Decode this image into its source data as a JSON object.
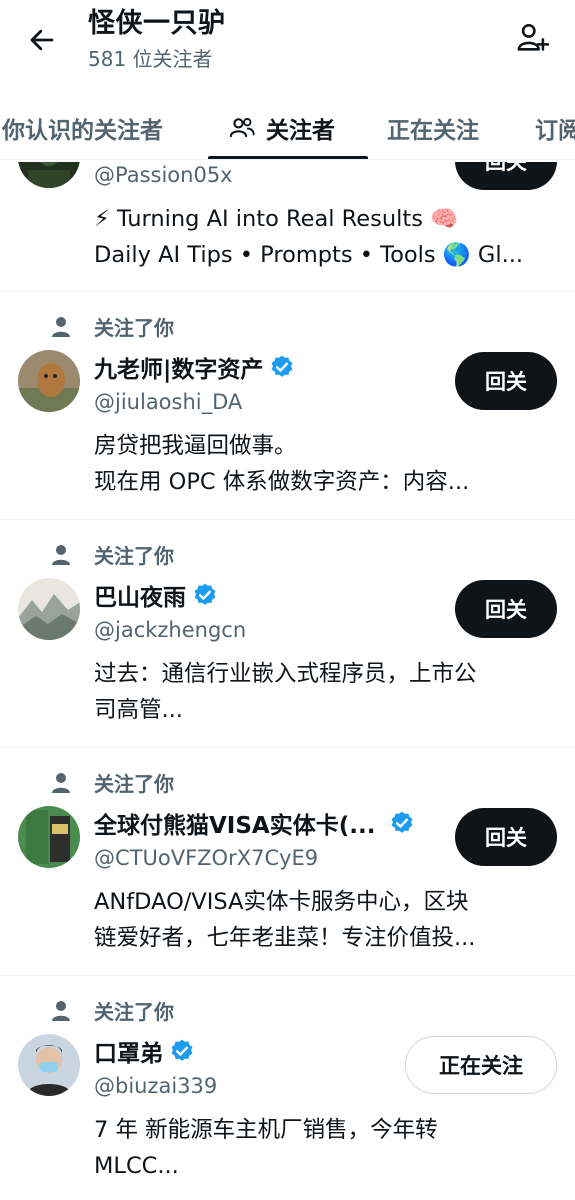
{
  "header": {
    "title": "怪侠一只驴",
    "subtitle": "581 位关注者"
  },
  "tabs": [
    {
      "label": "你认识的关注者"
    },
    {
      "label": "关注者"
    },
    {
      "label": "正在关注"
    },
    {
      "label": "订阅"
    }
  ],
  "followers": [
    {
      "handle": "@Passion05x",
      "bio1": "⚡ Turning AI into Real Results 🧠",
      "bio2": "Daily AI Tips • Prompts • Tools 🌎 Gl...",
      "button": "回关"
    },
    {
      "followed_text": "关注了你",
      "name": "九老师|数字资产",
      "handle": "@jiulaoshi_DA",
      "bio1": "房贷把我逼回做事。",
      "bio2": "现在用 OPC 体系做数字资产：内容...",
      "button": "回关"
    },
    {
      "followed_text": "关注了你",
      "name": "巴山夜雨",
      "handle": "@jackzhengcn",
      "bio1": "过去：通信行业嵌入式程序员，上市公",
      "bio2": "司高管...",
      "button": "回关"
    },
    {
      "followed_text": "关注了你",
      "name": "全球付熊猫VISA实体卡(...",
      "handle": "@CTUoVFZOrX7CyE9",
      "bio1": "ANfDAO/VISA实体卡服务中心，区块",
      "bio2": "链爱好者，七年老韭菜！专注价值投...",
      "button": "回关"
    },
    {
      "followed_text": "关注了你",
      "name": "口罩弟",
      "handle": "@biuzai339",
      "bio1": "7 年 新能源车主机厂销售，今年转",
      "bio2": "MLCC...",
      "button": "正在关注"
    }
  ],
  "colors": {
    "accent": "#1d9bf0",
    "text": "#0f1419",
    "secondary": "#536471",
    "button_dark": "#0f1419"
  }
}
